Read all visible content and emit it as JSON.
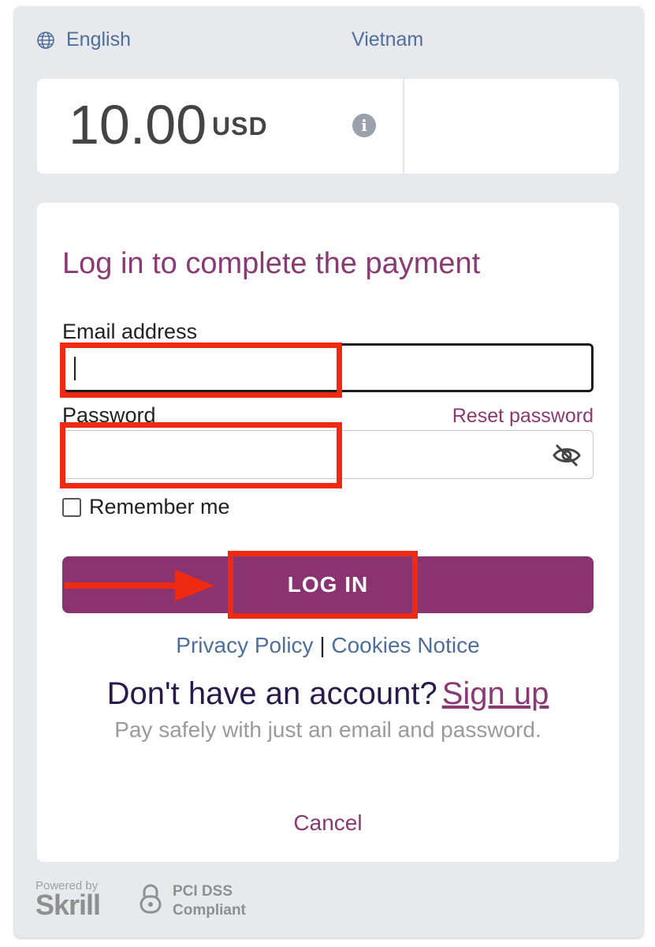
{
  "header": {
    "language": "English",
    "country": "Vietnam"
  },
  "amount": {
    "value": "10.00",
    "currency": "USD"
  },
  "login": {
    "title": "Log in to complete the payment",
    "email_label": "Email address",
    "email_value": "",
    "password_label": "Password",
    "password_value": "",
    "reset_password": "Reset password",
    "remember_me": "Remember me",
    "login_button": "LOG IN"
  },
  "links": {
    "privacy": "Privacy Policy",
    "separator": "|",
    "cookies": "Cookies Notice"
  },
  "signup": {
    "question": "Don't have an account?",
    "link": "Sign up",
    "tagline": "Pay safely with just an email and password."
  },
  "cancel": "Cancel",
  "footer": {
    "powered_by": "Powered by",
    "brand": "Skrill",
    "pci_line1": "PCI DSS",
    "pci_line2": "Compliant"
  },
  "icons": {
    "language": "globe-icon",
    "info": "info-icon",
    "password_visibility": "eye-slash-icon",
    "pci": "lock-icon"
  },
  "colors": {
    "brand": "#8b3270",
    "link": "#4f6f9a",
    "annotation": "#ee2a12"
  }
}
